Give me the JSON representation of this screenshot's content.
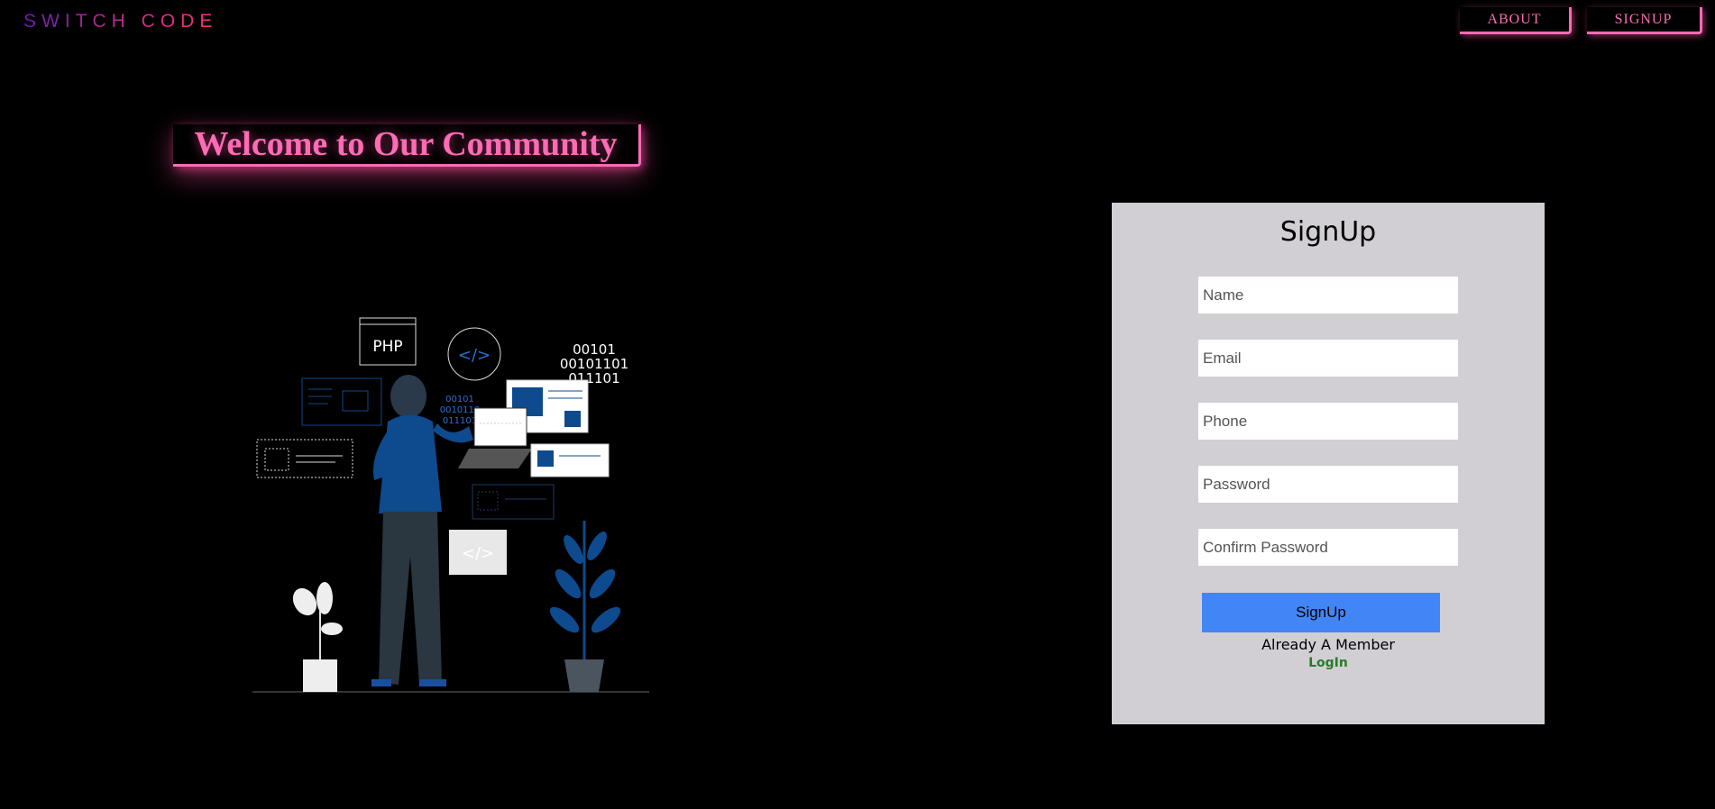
{
  "header": {
    "brand": "SWITCH CODE",
    "nav": {
      "about": "ABOUT",
      "signup": "SIGNUP"
    }
  },
  "hero": {
    "title": "Welcome to Our Community"
  },
  "illustration": {
    "php_label": "PHP",
    "binary_lines": [
      "00101",
      "00101101",
      "011101"
    ],
    "small_binary_lines": [
      "00101",
      "0010110",
      "011101"
    ]
  },
  "signup_form": {
    "title": "SignUp",
    "fields": {
      "name_placeholder": "Name",
      "email_placeholder": "Email",
      "phone_placeholder": "Phone",
      "password_placeholder": "Password",
      "confirm_placeholder": "Confirm Password"
    },
    "submit_label": "SignUp",
    "member_text": "Already A Member",
    "login_link": "LogIn"
  },
  "colors": {
    "accent_pink": "#ff6bb5",
    "card_bg": "#d2cfd4",
    "button_blue": "#4285f4",
    "link_green": "#2a7a2a"
  }
}
